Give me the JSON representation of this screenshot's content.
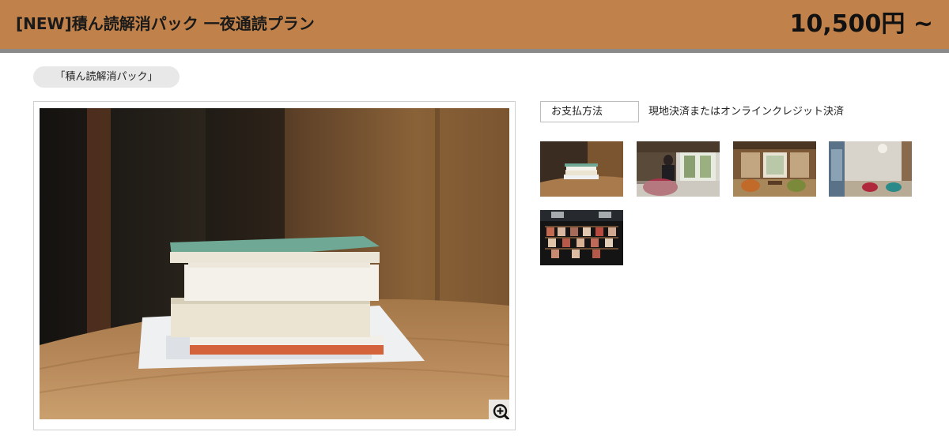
{
  "header": {
    "plan_title": "[NEW]積ん読解消パック 一夜通読プラン",
    "price": "10,500円 ~",
    "bg_color": "#c0824a"
  },
  "tag": {
    "label": "「積ん読解消パック」"
  },
  "payment": {
    "label": "お支払方法",
    "value": "現地決済またはオンラインクレジット決済"
  },
  "gallery": {
    "main_image": "stack-of-books-on-wooden-table",
    "zoom_icon": "zoom-in-icon",
    "thumbnails": [
      "books-on-table-thumbnail",
      "person-reading-thumbnail",
      "tatami-room-thumbnail",
      "lounge-room-thumbnail",
      "bookshelf-thumbnail"
    ]
  }
}
